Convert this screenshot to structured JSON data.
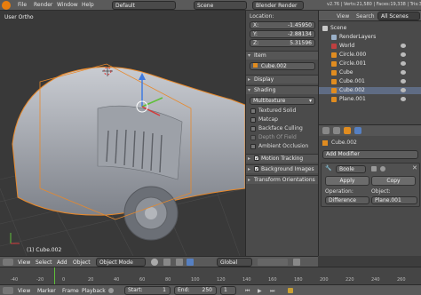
{
  "topbar": {
    "menus": [
      "File",
      "Render",
      "Window",
      "Help"
    ],
    "layout": "Default",
    "scene": "Scene",
    "engine": "Blender Render",
    "stats": "v2.76 | Verts:21,580 | Faces:19,338 | Tris:3"
  },
  "viewport": {
    "view_label": "User Ortho",
    "object_label": "(1) Cube.002"
  },
  "properties": {
    "location_header": "Location:",
    "x_label": "X:",
    "x_value": "-1.45950",
    "y_label": "Y:",
    "y_value": "-2.88134",
    "z_label": "Z:",
    "z_value": "5.31596",
    "item_header": "Item",
    "item_name": "Cube.002",
    "display_header": "Display",
    "shading_header": "Shading",
    "shading_mode": "Multitexture",
    "options": [
      {
        "label": "Textured Solid",
        "checked": false
      },
      {
        "label": "Matcap",
        "checked": false
      },
      {
        "label": "Backface Culling",
        "checked": false
      },
      {
        "label": "Depth Of Field",
        "checked": false
      },
      {
        "label": "Ambient Occlusion",
        "checked": false
      }
    ],
    "motion_tracking": "Motion Tracking",
    "background_images": "Background Images",
    "transform_orientations": "Transform Orientations"
  },
  "outliner": {
    "tabs": [
      "View",
      "Search",
      "All Scenes"
    ],
    "items": [
      {
        "label": "Scene",
        "indent": 0,
        "color": "#c9c9c9"
      },
      {
        "label": "RenderLayers",
        "indent": 1,
        "color": "#9ab0c8"
      },
      {
        "label": "World",
        "indent": 1,
        "color": "#c04040"
      },
      {
        "label": "Circle.000",
        "indent": 1,
        "color": "#e08c20"
      },
      {
        "label": "Circle.001",
        "indent": 1,
        "color": "#e08c20"
      },
      {
        "label": "Cube",
        "indent": 1,
        "color": "#e08c20"
      },
      {
        "label": "Cube.001",
        "indent": 1,
        "color": "#e08c20"
      },
      {
        "label": "Cube.002",
        "indent": 1,
        "color": "#e08c20"
      },
      {
        "label": "Plane.001",
        "indent": 1,
        "color": "#e08c20"
      }
    ]
  },
  "modifiers": {
    "object_name": "Cube.002",
    "add_modifier": "Add Modifier",
    "modifier_name": "Boole",
    "apply": "Apply",
    "copy": "Copy",
    "operation_label": "Operation:",
    "operation_value": "Difference",
    "object_label": "Object:",
    "object_value": "Plane.001"
  },
  "header3d": {
    "items": [
      "View",
      "Select",
      "Add",
      "Object"
    ],
    "mode": "Object Mode",
    "orientation": "Global"
  },
  "timeline": {
    "ticks": [
      "-40",
      "-20",
      "0",
      "20",
      "40",
      "60",
      "80",
      "100",
      "120",
      "140",
      "160",
      "180",
      "200",
      "220",
      "240",
      "260"
    ],
    "menus": [
      "View",
      "Marker",
      "Frame",
      "Playback"
    ],
    "start_label": "Start:",
    "start_value": "1",
    "end_label": "End:",
    "end_value": "250",
    "current": "1"
  },
  "colors": {
    "selection": "#e8892b",
    "accent": "#5680c2",
    "header": "#5a5a5a"
  }
}
